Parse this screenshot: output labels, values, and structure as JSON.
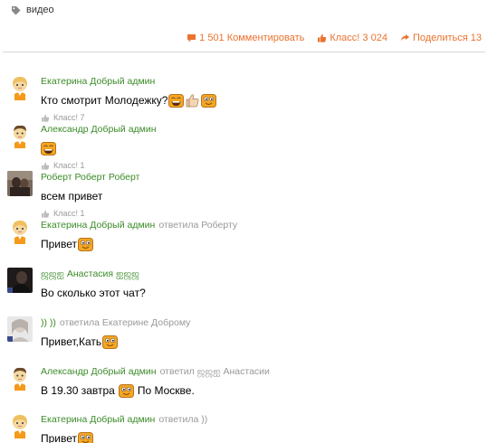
{
  "topic": {
    "tag_label": "видео"
  },
  "stats": {
    "comments": "1 501 Комментировать",
    "likes": "Класс! 3 024",
    "shares": "Поделиться 13"
  },
  "colors": {
    "accent": "#eb722e",
    "author": "#3b8b28",
    "muted": "#999999"
  },
  "comments": [
    {
      "author": "Екатерина Добрый админ",
      "reply_to": "",
      "text": "Кто смотрит Молодежку?",
      "emojis": [
        "laughing-face-icon",
        "thumbs-up-icon",
        "smiling-face-icon"
      ],
      "text_after": "",
      "likes": "Класс! 7",
      "avatar": "girl-avatar-icon"
    },
    {
      "author": "Александр Добрый админ",
      "reply_to": "",
      "text": "",
      "emojis": [
        "laughing-face-icon"
      ],
      "text_after": "",
      "likes": "Класс! 1",
      "avatar": "boy-avatar-icon"
    },
    {
      "author": "Роберт Роберт Роберт",
      "reply_to": "",
      "text": "всем привет",
      "emojis": [],
      "text_after": "",
      "likes": "Класс! 1",
      "avatar": "photo-avatar"
    },
    {
      "author": "Екатерина Добрый админ",
      "reply_to": "ответила Роберту",
      "text": "Привет",
      "emojis": [
        "smiling-face-icon"
      ],
      "text_after": "",
      "likes": "",
      "avatar": "girl-avatar-icon"
    },
    {
      "author": "ஜஜஐ Анастасия ஐஜஜ",
      "reply_to": "",
      "text": "Во сколько этот чат?",
      "emojis": [],
      "text_after": "",
      "likes": "",
      "avatar": "dark-photo-avatar"
    },
    {
      "author": ")) ))",
      "reply_to": "ответила Екатерине Доброму",
      "text": "Привет,Кать",
      "emojis": [
        "smiling-face-icon"
      ],
      "text_after": "",
      "likes": "",
      "avatar": "light-photo-avatar"
    },
    {
      "author": "Александр Добрый админ",
      "reply_to": "ответил ஜஜஐ Анастасии",
      "text": "В 19.30 завтра",
      "emojis": [
        "smiling-face-icon"
      ],
      "text_after": "По Москве.",
      "likes": "",
      "avatar": "boy-avatar-icon"
    },
    {
      "author": "Екатерина Добрый админ",
      "reply_to": "ответила ))",
      "text": "Привет",
      "emojis": [
        "smiling-face-icon"
      ],
      "text_after": "",
      "likes": "",
      "avatar": "girl-avatar-icon"
    }
  ]
}
